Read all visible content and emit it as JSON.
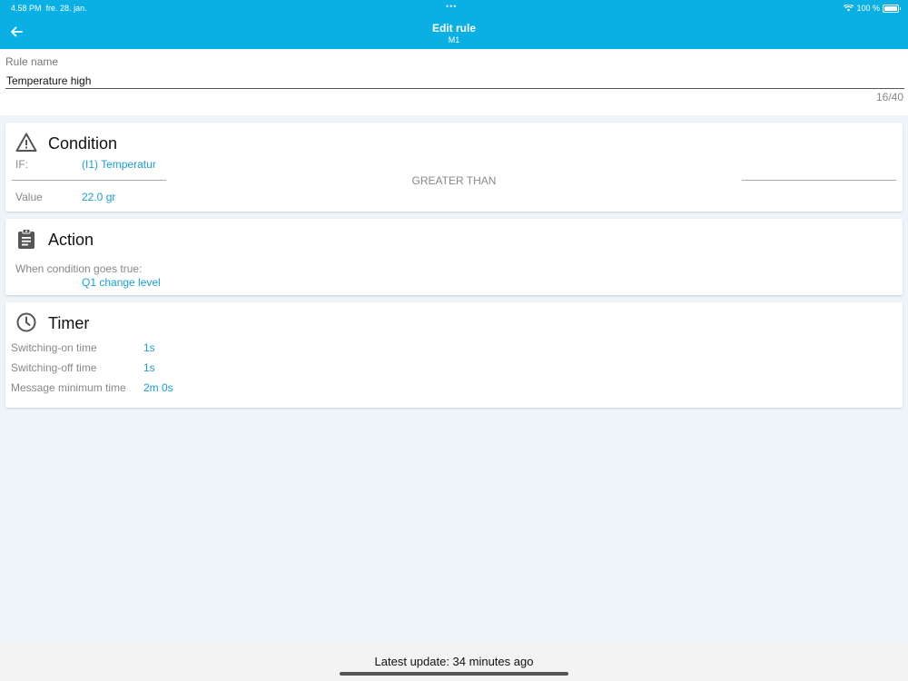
{
  "status_bar": {
    "time": "4.58 PM",
    "date": "fre. 28. jan.",
    "dots": "•••",
    "battery": "100 %"
  },
  "header": {
    "title": "Edit rule",
    "subtitle": "M1",
    "back_icon": "arrow-left-icon",
    "color": "#0ab0e4"
  },
  "rule_name": {
    "label": "Rule name",
    "value": "Temperature high",
    "counter": "16/40"
  },
  "condition": {
    "title": "Condition",
    "icon": "warning-triangle-icon",
    "if_label": "IF:",
    "if_value": "(I1) Temperatur",
    "operator": "GREATER THAN",
    "value_label": "Value",
    "value": "22.0 gr"
  },
  "action": {
    "title": "Action",
    "icon": "clipboard-icon",
    "when_label": "When condition goes true:",
    "when_value": "Q1 change level"
  },
  "timer": {
    "title": "Timer",
    "icon": "clock-icon",
    "rows": [
      {
        "label": "Switching-on time",
        "value": "1s"
      },
      {
        "label": "Switching-off time",
        "value": "1s"
      },
      {
        "label": "Message minimum time",
        "value": "2m 0s"
      }
    ]
  },
  "footer": {
    "text": "Latest update: 34 minutes ago"
  },
  "colors": {
    "accent": "#0ab0e4",
    "link": "#1a9fd6",
    "background": "#eef4f8"
  }
}
